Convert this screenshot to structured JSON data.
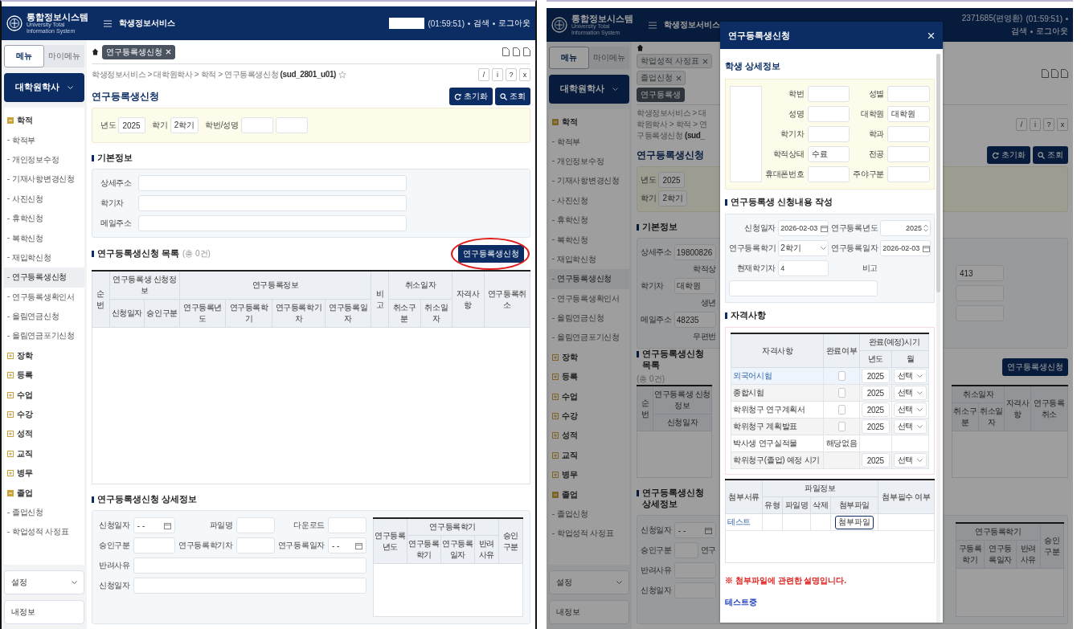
{
  "screens": [
    {
      "dimmed": false,
      "header": {
        "logo": "통합정보시스템",
        "logo_subtitle": "University Total Information System",
        "service": "학생정보서비스",
        "timer": "(01:59:51)",
        "links": [
          "검색",
          "로그아웃"
        ]
      },
      "sidebar": {
        "tabs": [
          {
            "label": "메뉴",
            "selected": true
          },
          {
            "label": "마이메뉴",
            "selected": false
          }
        ],
        "category": "대학원학사",
        "groups": [
          {
            "label": "학적",
            "expanded": true,
            "children": [
              {
                "label": "학적부",
                "selected": false
              },
              {
                "label": "개인정보수정",
                "selected": false
              },
              {
                "label": "기재사항변경신청",
                "selected": false
              },
              {
                "label": "사진신청",
                "selected": false
              },
              {
                "label": "휴학신청",
                "selected": false
              },
              {
                "label": "복학신청",
                "selected": false
              },
              {
                "label": "재입학신청",
                "selected": false
              },
              {
                "label": "연구등록생신청",
                "selected": true
              },
              {
                "label": "연구등록생확인서",
                "selected": false
              },
              {
                "label": "올림연금신청",
                "selected": false
              },
              {
                "label": "올림연금포기신청",
                "selected": false
              }
            ]
          },
          {
            "label": "장학",
            "expanded": false
          },
          {
            "label": "등록",
            "expanded": false
          },
          {
            "label": "수업",
            "expanded": false
          },
          {
            "label": "수강",
            "expanded": false
          },
          {
            "label": "성적",
            "expanded": false
          },
          {
            "label": "교직",
            "expanded": false
          },
          {
            "label": "병무",
            "expanded": false
          },
          {
            "label": "졸업",
            "expanded": true,
            "children": [
              {
                "label": "졸업신청",
                "selected": false
              },
              {
                "label": "학업성적 사정표",
                "selected": false
              }
            ]
          }
        ],
        "footer": [
          {
            "label": "설정",
            "kind": "dropdown"
          },
          {
            "label": "내정보",
            "kind": "link"
          }
        ]
      },
      "main": {
        "kind": "full",
        "tabs": [
          {
            "label": "연구등록생신청",
            "selected": true,
            "closable": true
          }
        ],
        "breadcrumb": "학생정보서비스 > 대학원학사 > 학적 > 연구등록생신청 **(sud_2801_u01)**",
        "tools": [
          "/",
          "i",
          "?",
          "x"
        ],
        "page_title": "연구등록생신청",
        "page_buttons": [
          {
            "label": "초기화",
            "kind": "reset"
          },
          {
            "label": "조회",
            "kind": "search"
          }
        ],
        "search": [
          {
            "label": "년도",
            "kind": "text",
            "value": "2025"
          },
          {
            "label": "학기",
            "kind": "text",
            "value": "2학기"
          },
          {
            "label": "학번/성명",
            "kind": "pair"
          }
        ],
        "basic_info": {
          "title": "기본정보",
          "rows": [
            {
              "label": "상세주소"
            },
            {
              "label": "학기차"
            },
            {
              "label": "메일주소"
            }
          ]
        },
        "list": {
          "title": "연구등록생신청 목록",
          "count": "(총 0건)",
          "button": {
            "label": "연구등록생신청",
            "circled": true
          },
          "columns": [
            {
              "label": "순번"
            },
            {
              "label": "연구등록생 신청정보",
              "children": [
                "신청일자",
                "승인구분"
              ]
            },
            {
              "label": "연구등록정보",
              "children": [
                "연구등록년도",
                "연구등록학기",
                "연구등록학기차",
                "연구등록일자"
              ]
            },
            {
              "label": "비고"
            },
            {
              "label": "취소일자",
              "children": [
                "취소구분",
                "취소일자"
              ]
            },
            {
              "label": "자격사항"
            },
            {
              "label": "연구등록취소"
            }
          ]
        },
        "detail": {
          "title": "연구등록생신청 상세정보",
          "form": [
            [
              {
                "label": "신청일자",
                "kind": "date",
                "value": "- -"
              },
              {
                "label": "파일명",
                "kind": "text"
              },
              {
                "label": "다운로드",
                "kind": "text"
              }
            ],
            [
              {
                "label": "승인구분",
                "kind": "text"
              },
              {
                "label": "연구등록학기차",
                "kind": "text"
              },
              {
                "label": "연구등록일자",
                "kind": "date",
                "value": "- -"
              }
            ],
            [
              {
                "label": "반려사유",
                "kind": "wide"
              }
            ],
            [
              {
                "label": "신청일자",
                "kind": "wide"
              }
            ]
          ],
          "columns": [
            {
              "label": "연구등록년도"
            },
            {
              "label": "연구등록학기",
              "children": [
                "연구등록학기",
                "연구등록일자",
                "반려사유"
              ]
            },
            {
              "label": "승인구분"
            }
          ]
        }
      }
    },
    {
      "dimmed": true,
      "header": {
        "logo": "통합정보시스템",
        "logo_subtitle": "University Total Information System",
        "service": "학생정보서비스",
        "user": "2371685(편영환)",
        "timer": "(01:59:51)",
        "links": [
          "검색",
          "로그아웃"
        ]
      },
      "sidebar": {
        "tabs": [
          {
            "label": "메뉴",
            "selected": true
          },
          {
            "label": "마이메뉴",
            "selected": false
          }
        ],
        "category": "대학원학사",
        "groups": [
          {
            "label": "학적",
            "expanded": true,
            "children": [
              {
                "label": "학적부",
                "selected": false
              },
              {
                "label": "개인정보수정",
                "selected": false
              },
              {
                "label": "기재사항변경신청",
                "selected": false
              },
              {
                "label": "사진신청",
                "selected": false
              },
              {
                "label": "휴학신청",
                "selected": false
              },
              {
                "label": "복학신청",
                "selected": false
              },
              {
                "label": "재입학신청",
                "selected": false
              },
              {
                "label": "연구등록생신청",
                "selected": true
              },
              {
                "label": "연구등록생확인서",
                "selected": false
              },
              {
                "label": "올림연금신청",
                "selected": false
              },
              {
                "label": "올림연금포기신청",
                "selected": false
              }
            ]
          },
          {
            "label": "장학",
            "expanded": false
          },
          {
            "label": "등록",
            "expanded": false
          },
          {
            "label": "수업",
            "expanded": false
          },
          {
            "label": "수강",
            "expanded": false
          },
          {
            "label": "성적",
            "expanded": false
          },
          {
            "label": "교직",
            "expanded": false
          },
          {
            "label": "병무",
            "expanded": false
          },
          {
            "label": "졸업",
            "expanded": true,
            "children": [
              {
                "label": "졸업신청",
                "selected": false
              },
              {
                "label": "학업성적 사정표",
                "selected": false
              }
            ]
          }
        ],
        "footer": [
          {
            "label": "설정",
            "kind": "dropdown"
          },
          {
            "label": "내정보",
            "kind": "link"
          }
        ]
      },
      "main": {
        "kind": "split",
        "tabs": [
          {
            "label": "학업성적 사정표",
            "selected": false,
            "closable": true
          },
          {
            "label": "졸업신청",
            "selected": false,
            "closable": true
          },
          {
            "label": "연구등록생",
            "selected": true,
            "closable": false
          }
        ],
        "breadcrumb": "학생정보서비스 > 대학원학사 > 학적 > 연구등록생신청 **(sud_**",
        "tools": [
          "/",
          "i",
          "?",
          "x"
        ],
        "page_title": "연구등록생신청",
        "page_buttons": [
          {
            "label": "초기화",
            "kind": "reset"
          },
          {
            "label": "조회",
            "kind": "search"
          }
        ],
        "search": [
          {
            "label": "년도",
            "kind": "text",
            "value": "2025"
          },
          {
            "label": "학기",
            "kind": "text",
            "value": "2학기"
          }
        ],
        "basic_info": {
          "title": "기본정보",
          "rows": [
            {
              "label": "상세주소",
              "value": "19800826",
              "cut_label": "학적상",
              "far_value": "413"
            },
            {
              "label": "학기차",
              "value": "대학원",
              "cut_label": "생년"
            },
            {
              "label": "메일주소",
              "value": "48235",
              "cut_label": "우편번"
            }
          ]
        },
        "list": {
          "title": "연구등록생신청 목록",
          "count": "(총 0건)",
          "button": {
            "label": "연구등록생신청",
            "circled": false
          },
          "left_columns": [
            {
              "label": "순번"
            },
            {
              "label": "연구등록생 신청정보",
              "children": [
                "신청일자"
              ]
            }
          ],
          "right_columns": [
            {
              "label": "취소일자",
              "children": [
                "취소구분",
                "취소일자"
              ]
            },
            {
              "label": "자격사항"
            },
            {
              "label": "연구등록취소"
            }
          ]
        },
        "detail": {
          "title": "연구등록생신청 상세정보",
          "form": [
            [
              {
                "label": "신청일자",
                "kind": "date",
                "value": "- -"
              }
            ],
            [
              {
                "label": "승인구분",
                "kind": "text",
                "cut_label": "연구"
              }
            ],
            [
              {
                "label": "반려사유",
                "kind": "wide"
              }
            ],
            [
              {
                "label": "신청일자",
                "kind": "wide"
              }
            ]
          ],
          "right_columns": [
            {
              "label": "연구등록학기",
              "children": [
                "구등록학기",
                "연구등록일자",
                "반려사유"
              ]
            },
            {
              "label": "승인구분"
            }
          ]
        }
      },
      "modal": {
        "title": "연구등록생신청",
        "student": {
          "title": "학생 상세정보",
          "fields": [
            {
              "label": "학번"
            },
            {
              "label": "성별"
            },
            {
              "label": "성명"
            },
            {
              "label": "대학원",
              "value": "대학원"
            },
            {
              "label": "학기차"
            },
            {
              "label": "학과"
            },
            {
              "label": "학적상태",
              "value": "수료"
            },
            {
              "label": "전공"
            },
            {
              "label": "휴대폰번호"
            },
            {
              "label": "주야구분"
            }
          ]
        },
        "application": {
          "title": "연구등록생 신청내용 작성",
          "fields": [
            {
              "label": "신청일자",
              "kind": "date",
              "value": "2026-02-03"
            },
            {
              "label": "연구등록년도",
              "kind": "spin",
              "value": "2025"
            },
            {
              "label": "연구등록학기",
              "kind": "select",
              "value": "2학기"
            },
            {
              "label": "연구등록일자",
              "kind": "date",
              "value": "2026-02-03"
            },
            {
              "label": "현재학기차",
              "kind": "text",
              "value": "4"
            },
            {
              "label": "비고",
              "kind": "wide"
            }
          ]
        },
        "qualifications": {
          "title": "자격사항",
          "columns": [
            {
              "label": "자격사항"
            },
            {
              "label": "완료여부"
            },
            {
              "label": "완료(예정)시기",
              "children": [
                "년도",
                "월"
              ]
            }
          ],
          "rows": [
            {
              "name": "외국어시험",
              "kind": "check",
              "checked": false,
              "year": "2025",
              "month": "선택",
              "selected": true
            },
            {
              "name": "종합시험",
              "kind": "check",
              "checked": false,
              "year": "2025",
              "month": "선택",
              "selected": false
            },
            {
              "name": "학위청구 연구계획서",
              "kind": "check",
              "checked": false,
              "year": "2025",
              "month": "선택",
              "selected": false
            },
            {
              "name": "학위청구 계획발표",
              "kind": "check",
              "checked": false,
              "year": "2025",
              "month": "선택",
              "selected": false
            },
            {
              "name": "박사생 연구실적물",
              "kind": "na",
              "status": "해당없음",
              "selected": false
            },
            {
              "name": "학위청구(졸업) 예정 시기",
              "kind": "none",
              "year": "2025",
              "month": "선택",
              "selected": false
            }
          ]
        },
        "attachments": {
          "columns": [
            {
              "label": "첨부서류"
            },
            {
              "label": "파일정보",
              "children": [
                "유형",
                "파일명",
                "삭제",
                "첨부파일"
              ]
            },
            {
              "label": "첨부필수 여부"
            }
          ],
          "rows": [
            {
              "document": "테스트",
              "button": "첨부파일"
            }
          ]
        },
        "note": "※ 첨부파일에 관련한 설명입니다.",
        "footer_text": "테스트중"
      }
    }
  ]
}
